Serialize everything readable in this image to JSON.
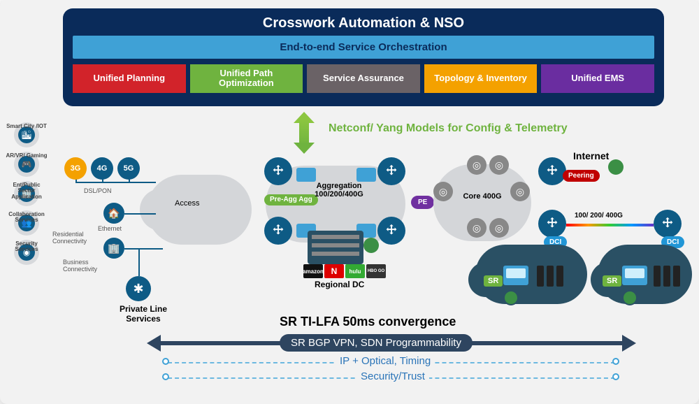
{
  "banner": {
    "title": "Crosswork Automation & NSO",
    "e2e": "End-to-end Service Orchestration",
    "tiles": {
      "planning": "Unified Planning",
      "path": "Unified Path Optimization",
      "assurance": "Service Assurance",
      "topology": "Topology & Inventory",
      "ems": "Unified EMS"
    }
  },
  "netconf": "Netconf/ Yang Models for Config & Telemetry",
  "usecases": {
    "smartcity": "Smart City /IOT",
    "arvr": "AR/VR/ Gaming",
    "ent": "Ent/Public Sector Application",
    "collab": "Collaboration Services",
    "security": "Security Services"
  },
  "access": {
    "g3": "3G",
    "g4": "4G",
    "g5": "5G",
    "dslpon": "DSL/PON",
    "ethernet": "Ethernet",
    "residential": "Residential Connectivity",
    "business": "Business Connectivity",
    "privateline": "Private Line Services",
    "access_label": "Access"
  },
  "mid": {
    "preagg": "Pre-Agg Agg",
    "aggregation": "Aggregation 100/200/400G",
    "pe": "PE",
    "core": "Core 400G",
    "regional_dc": "Regional DC",
    "internet": "Internet",
    "peering": "Peering",
    "dci": "DCI",
    "sr": "SR",
    "link_speed": "100/ 200/ 400G"
  },
  "streaming": {
    "amazon": "amazon",
    "netflix": "N",
    "hulu": "hulu",
    "hbo": "HBO GO"
  },
  "bottom": {
    "convergence": "SR TI-LFA 50ms convergence",
    "bgp": "SR BGP VPN, SDN Programmability",
    "ipoptical": "IP + Optical, Timing",
    "security": "Security/Trust"
  }
}
